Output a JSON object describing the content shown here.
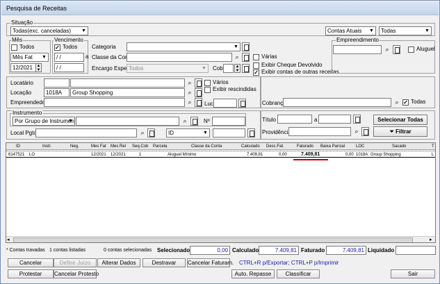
{
  "window": {
    "title": "Pesquisa de Receitas"
  },
  "situacao": {
    "legend": "Situação",
    "value": "Todas(exc. canceladas)",
    "contas": "Contas Atuais",
    "todas": "Todas"
  },
  "mes": {
    "legend": "Mês",
    "todos": "Todos",
    "tipo": "Mês Fat",
    "valor": "12/2021"
  },
  "vencimento": {
    "legend": "Vencimento",
    "todos": "Todos",
    "de": "/ /",
    "ate_label": "a",
    "ate": "/ /"
  },
  "categoria": {
    "categoria_label": "Categoria",
    "categoria_value": "",
    "classe_label": "Classe da Conta",
    "classe_value": "",
    "encargo_label": "Encargo Espec.",
    "encargo_value": "Todos",
    "cobr_label": "Cobr",
    "varias": "Várias",
    "exibir_cheque": "Exibir Cheque Devolvido",
    "exibir_outras": "Exibir contas de outras receitas"
  },
  "empreendimento": {
    "legend": "Empreendimento",
    "value": "",
    "aluguel": "Aluguel"
  },
  "locatario": {
    "locatario_label": "Locatário",
    "locatario_code": "",
    "locatario_value": "",
    "locacao_label": "Locação",
    "locacao_code": "1018A",
    "locacao_value": "Group Shopping",
    "empreendedor_label": "Empreendedor",
    "empreendedor_value": "",
    "luc_label": "Luc",
    "varios": "Vários",
    "exibir_rescindidas": "Exibir rescindidas"
  },
  "cobranca": {
    "label": "Cobrança",
    "value": "",
    "todas": "Todas"
  },
  "instrumento": {
    "legend": "Instrumento",
    "value": "Por Grupo de Instrumento",
    "n_label": "Nº",
    "n_value": "",
    "local_pgto_label": "Local Pgto",
    "local_pgto_value": "",
    "id_select": "ID",
    "id_value": ""
  },
  "titulo": {
    "label": "Título",
    "de": "",
    "a_label": "a",
    "ate": "",
    "providencia_label": "Providência",
    "providencia_value": ""
  },
  "actions": {
    "selecionar_todas": "Selecionar Todas",
    "filtrar": "Filtrar"
  },
  "grid": {
    "columns": [
      "ID",
      "Instr.",
      "Neg.",
      "Mes Fat",
      "Mes Rel",
      "Seq.Cob",
      "Parcela",
      "Classe da Conta",
      "Calculado",
      "Desc.Fat.",
      "Faturado",
      "Baixa Parcial",
      "LOC",
      "Sacado",
      "T"
    ],
    "rows": [
      [
        "6147521",
        "LO",
        "",
        "12/2021",
        "12/2021",
        "1",
        "",
        "Aluguel Mínimo",
        "7.409,81",
        "0,00",
        "7.409,81",
        "0,00",
        "1018A",
        "Group Shopping",
        "L"
      ]
    ]
  },
  "summary": {
    "travadas": "* Contas travadas",
    "listadas": "1 contas listadas",
    "selecionadas": "0 contas selecionadas",
    "selecionado_label": "Selecionado",
    "selecionado_value": "0,00",
    "calculado_label": "Calculado",
    "calculado_value": "7.409,81",
    "faturado_label": "Faturado",
    "faturado_value": "7.409,81",
    "liquidado_label": "Liquidado",
    "liquidado_value": ""
  },
  "buttons": {
    "cancelar": "Cancelar",
    "definir_juizo": "Definir Juízo",
    "alterar_dados": "Alterar Dados",
    "destravar": "Destravar",
    "cancelar_faturam": "Cancelar Faturam.",
    "protestar": "Protestar",
    "cancelar_protesto": "Cancelar Protesto",
    "auto_repasse": "Auto. Repasse",
    "classificar": "Classificar",
    "sair": "Sair",
    "shortcut_hint": "CTRL+R p/Exportar; CTRL+P p/Imprimir"
  },
  "colors": {
    "highlight": "#c00000",
    "hint": "#1a1ab0",
    "title_bg": "#c4d5ea"
  }
}
